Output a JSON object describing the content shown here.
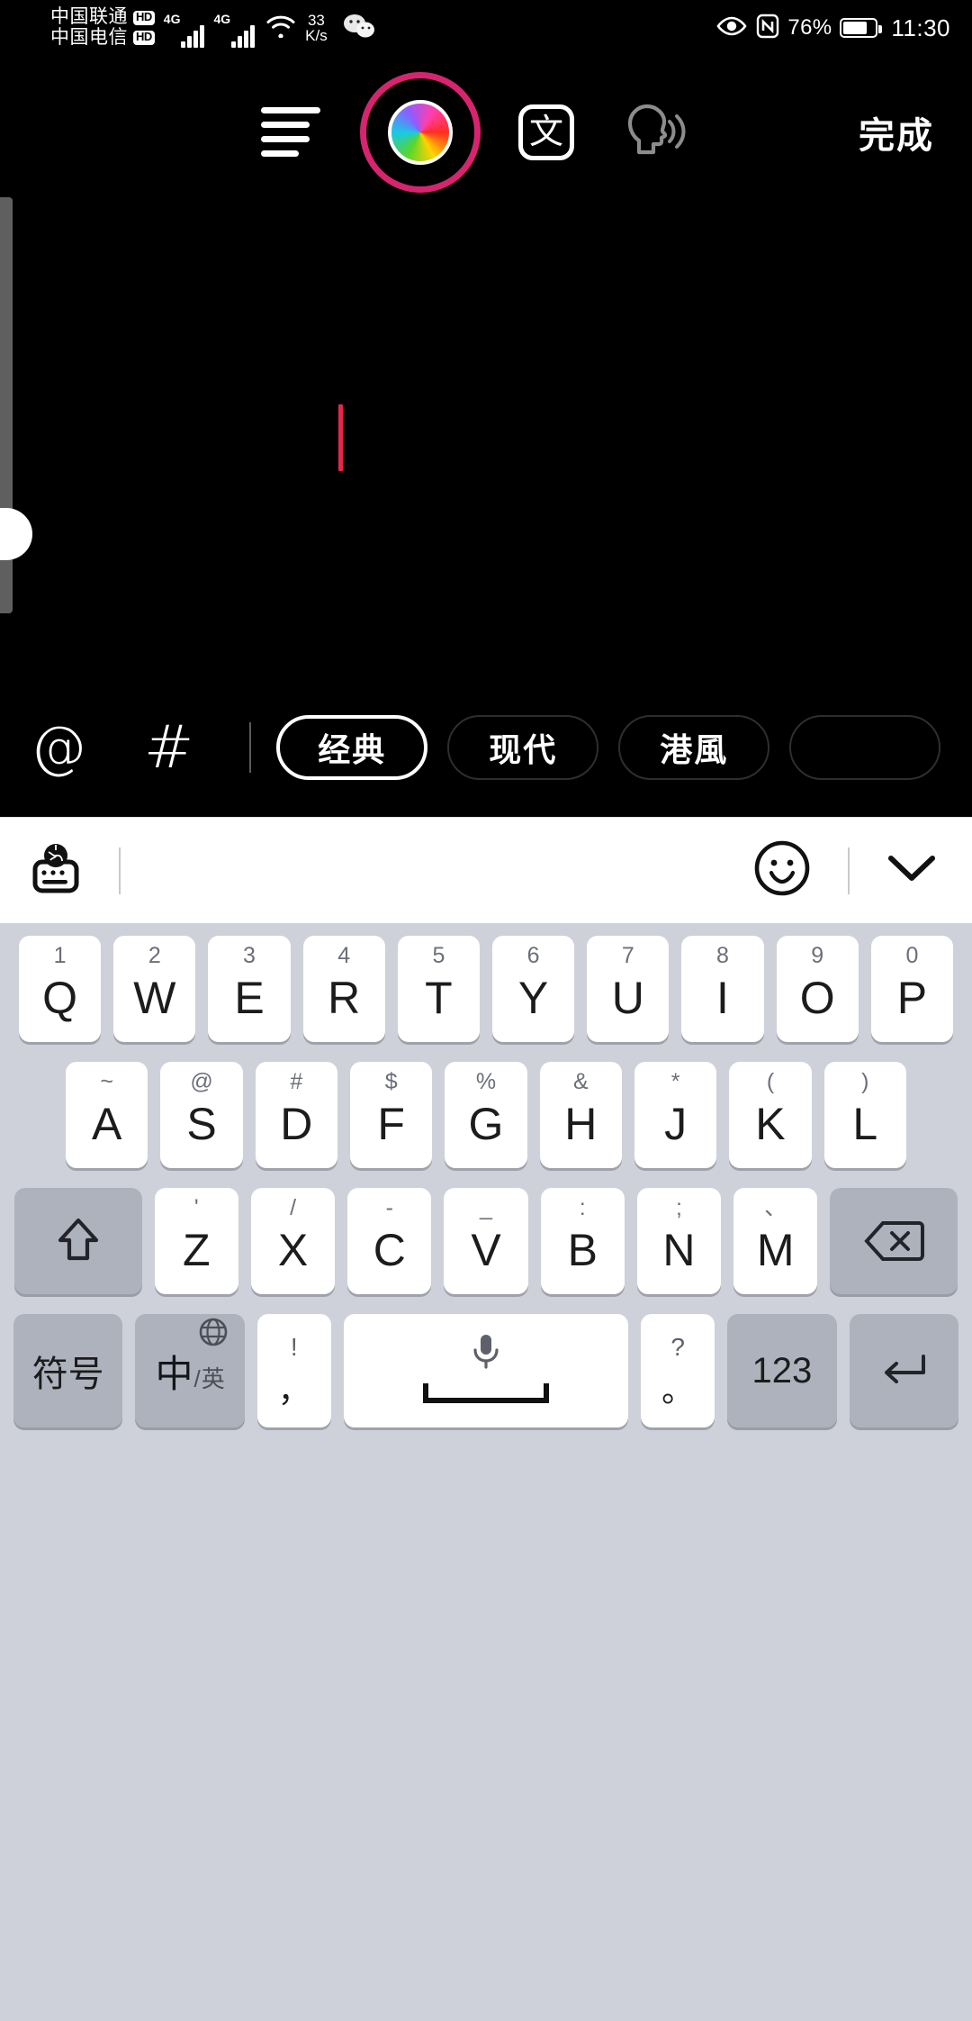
{
  "status_bar": {
    "carrier_1": "中国联通",
    "carrier_1_badge": "HD",
    "carrier_2": "中国电信",
    "carrier_2_badge": "HD",
    "network_1": "4G",
    "network_2": "4G",
    "net_speed_value": "33",
    "net_speed_unit": "K/s",
    "battery_percent": "76%",
    "battery_level": 76,
    "time": "11:30",
    "icons": [
      "wifi-icon",
      "wechat-icon",
      "eye-comfort-icon",
      "nfc-icon",
      "battery-icon"
    ]
  },
  "editor_toolbar": {
    "align_label": "text-align-icon",
    "color_label": "color-wheel-icon",
    "color_ring_hex": "#d6246e",
    "lang_label": "文",
    "tts_label": "text-to-speech-icon",
    "done_label": "完成"
  },
  "canvas": {
    "caret_color": "#e8264b",
    "background": "#000000"
  },
  "chip_bar": {
    "mention_icon": "@",
    "hashtag_icon": "#",
    "styles": [
      {
        "label": "经典",
        "selected": true
      },
      {
        "label": "现代",
        "selected": false
      },
      {
        "label": "港風",
        "selected": false
      },
      {
        "label": "",
        "selected": false
      }
    ]
  },
  "keyboard": {
    "toolbar": {
      "left_icon": "globe-keyboard-icon",
      "emoji_icon": "emoji-icon",
      "collapse_icon": "chevron-down-icon"
    },
    "row1": [
      {
        "sup": "1",
        "main": "Q"
      },
      {
        "sup": "2",
        "main": "W"
      },
      {
        "sup": "3",
        "main": "E"
      },
      {
        "sup": "4",
        "main": "R"
      },
      {
        "sup": "5",
        "main": "T"
      },
      {
        "sup": "6",
        "main": "Y"
      },
      {
        "sup": "7",
        "main": "U"
      },
      {
        "sup": "8",
        "main": "I"
      },
      {
        "sup": "9",
        "main": "O"
      },
      {
        "sup": "0",
        "main": "P"
      }
    ],
    "row2": [
      {
        "sup": "~",
        "main": "A"
      },
      {
        "sup": "@",
        "main": "S"
      },
      {
        "sup": "#",
        "main": "D"
      },
      {
        "sup": "$",
        "main": "F"
      },
      {
        "sup": "%",
        "main": "G"
      },
      {
        "sup": "&",
        "main": "H"
      },
      {
        "sup": "*",
        "main": "J"
      },
      {
        "sup": "(",
        "main": "K"
      },
      {
        "sup": ")",
        "main": "L"
      }
    ],
    "row3": {
      "shift": "shift-icon",
      "keys": [
        {
          "sup": "'",
          "main": "Z"
        },
        {
          "sup": "/",
          "main": "X"
        },
        {
          "sup": "-",
          "main": "C"
        },
        {
          "sup": "_",
          "main": "V"
        },
        {
          "sup": ":",
          "main": "B"
        },
        {
          "sup": ";",
          "main": "N"
        },
        {
          "sup": "、",
          "main": "M"
        }
      ],
      "backspace": "backspace-icon"
    },
    "row4": {
      "symbols": "符号",
      "lang_zh": "中",
      "lang_sep": "/",
      "lang_en": "英",
      "comma_up": "!",
      "comma_dn": "，",
      "space_icon": "microphone-icon",
      "period_up": "?",
      "period_dn": "。",
      "numeric": "123",
      "enter": "enter-icon"
    }
  }
}
